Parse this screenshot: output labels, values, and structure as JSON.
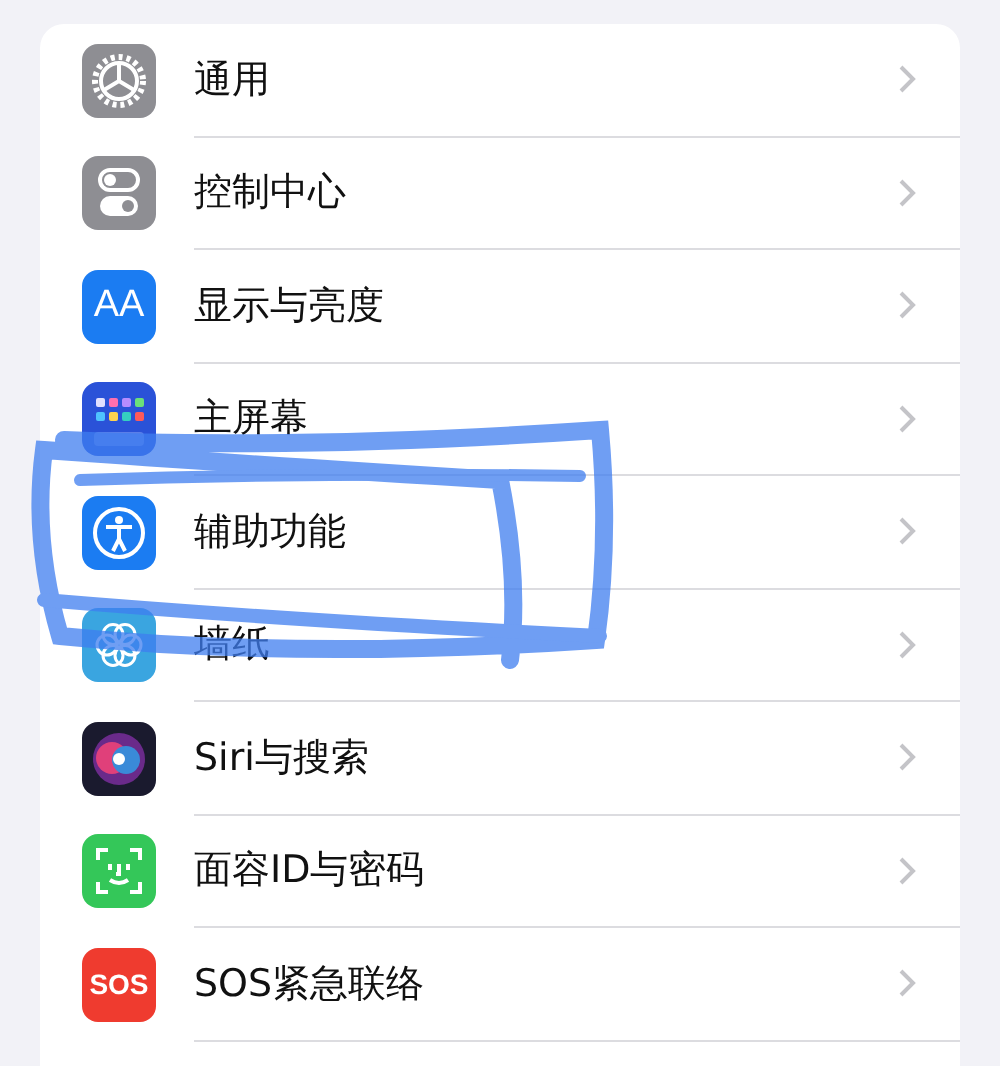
{
  "settings_rows": [
    {
      "label": "通用",
      "kind": "gear"
    },
    {
      "label": "控制中心",
      "kind": "toggles"
    },
    {
      "label": "显示与亮度",
      "kind": "text",
      "icon_text": "AA"
    },
    {
      "label": "主屏幕",
      "kind": "grid"
    },
    {
      "label": "辅助功能",
      "kind": "accessibility"
    },
    {
      "label": "墙纸",
      "kind": "flower"
    },
    {
      "label": "Siri与搜索",
      "kind": "orb"
    },
    {
      "label": "面容ID与密码",
      "kind": "face"
    },
    {
      "label": "SOS紧急联络",
      "kind": "text",
      "icon_text": "SOS"
    }
  ],
  "annotation": {
    "kind": "scribble"
  }
}
